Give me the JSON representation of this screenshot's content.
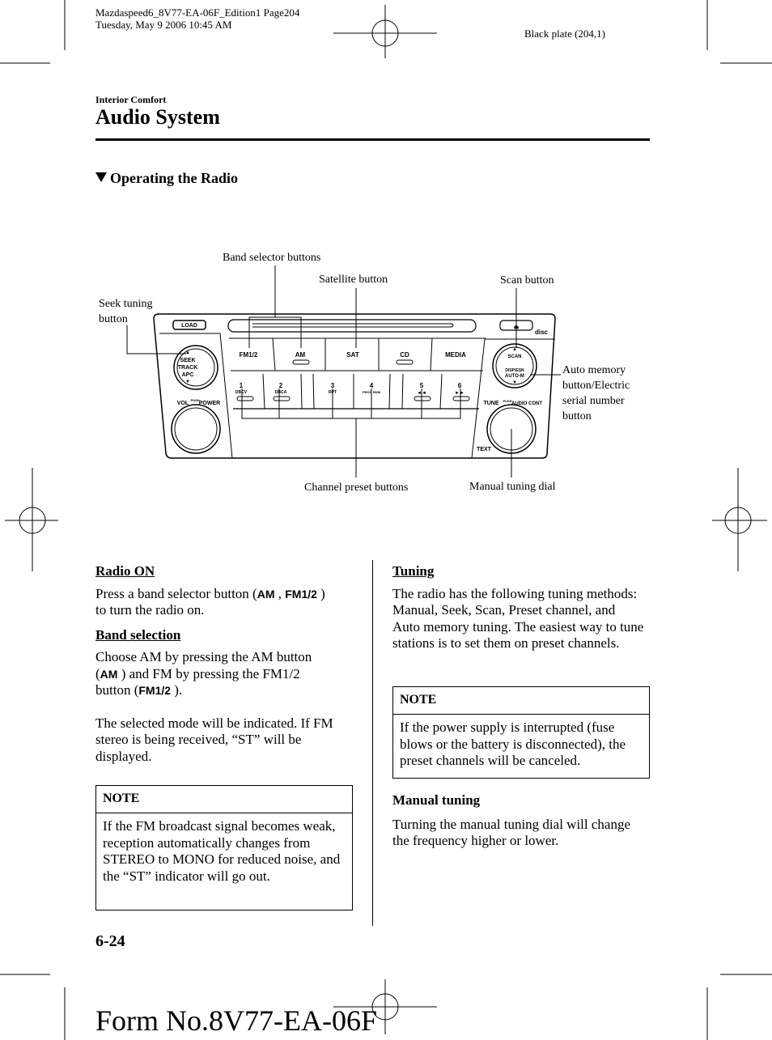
{
  "print_header": {
    "line1": "Mazdaspeed6_8V77-EA-06F_Edition1 Page204",
    "line2": "Tuesday, May 9 2006 10:45 AM",
    "plate": "Black plate (204,1)"
  },
  "section_label": "Interior Comfort",
  "page_title": "Audio System",
  "subheading": "Operating the Radio",
  "diagram": {
    "callouts": {
      "band_selector": "Band selector buttons",
      "satellite": "Satellite button",
      "scan": "Scan button",
      "seek_l1": "Seek tuning",
      "seek_l2": "button",
      "auto_l1": "Auto memory",
      "auto_l2": "button/Electric",
      "auto_l3": "serial number",
      "auto_l4": "button",
      "channel_preset": "Channel preset buttons",
      "manual_dial": "Manual tuning dial"
    },
    "panel": {
      "load": "LOAD",
      "band_buttons": [
        "FM1/2",
        "AM",
        "SAT",
        "CD",
        "MEDIA"
      ],
      "presets": [
        {
          "num": "1",
          "sub": "DBCV"
        },
        {
          "num": "2",
          "sub": "DBCA"
        },
        {
          "num": "3",
          "sub": "RPT"
        },
        {
          "num": "4",
          "sub": "PROG RDM"
        },
        {
          "num": "5",
          "sub": "◄◄"
        },
        {
          "num": "6",
          "sub": "►►"
        }
      ],
      "seek": [
        "SEEK",
        "TRACK",
        "APC"
      ],
      "vol": "VOL",
      "push": "PUSH",
      "power": "POWER",
      "scan": "SCAN",
      "disp": "DISP/ESN",
      "autom": "AUTO-M",
      "tune": "TUNE",
      "audio": "AUDIO CONT",
      "text": "TEXT",
      "disc": "disc"
    }
  },
  "left_column": {
    "radio_on_heading": "Radio ON",
    "radio_on_text_a": "Press a band selector button (",
    "btn_am": "AM",
    "sep": " , ",
    "btn_fm": "FM1/2",
    "radio_on_text_b": " )",
    "radio_on_text_c": "to turn the radio on.",
    "band_heading": "Band selection",
    "band_text_a": "Choose AM by pressing the AM button",
    "band_text_b1": "(",
    "band_text_b2": " ) and FM by pressing the FM1/2",
    "band_text_c1": "button (",
    "band_text_c2": " ).",
    "mode_text": "The selected mode will be indicated. If FM stereo is being received, “ST” will be displayed.",
    "note_title": "NOTE",
    "note_body": "If the FM broadcast signal becomes weak, reception automatically changes from STEREO to MONO for reduced noise, and the “ST” indicator will go out."
  },
  "right_column": {
    "tuning_heading": "Tuning",
    "tuning_text": "The radio has the following tuning methods: Manual, Seek, Scan, Preset channel, and Auto memory tuning. The easiest way to tune stations is to set them on preset channels.",
    "note_title": "NOTE",
    "note_body": "If the power supply is interrupted (fuse blows or the battery is disconnected), the preset channels will be canceled.",
    "manual_heading": "Manual tuning",
    "manual_text": "Turning the manual tuning dial will change the frequency higher or lower."
  },
  "page_number": "6-24",
  "form_number": "Form No.8V77-EA-06F"
}
